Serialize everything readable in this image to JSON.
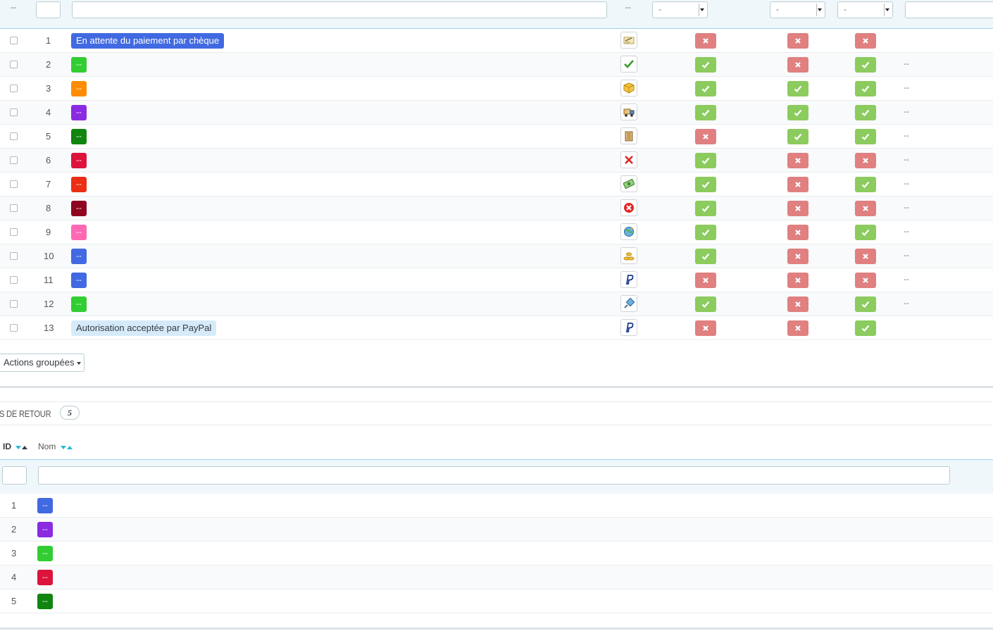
{
  "order_states_table": {
    "filters": {
      "id_dash": "--",
      "id_value": "",
      "name_value": "",
      "icon_dash": "--",
      "send_email": "-",
      "delivery": "-",
      "invoice": "-",
      "template_value": ""
    },
    "rows": [
      {
        "id": "1",
        "name": "En attente du paiement par chèque",
        "color": "#4169e1",
        "text_color": "#ffffff",
        "icon": "cheque-icon",
        "send_email": false,
        "delivery": false,
        "invoice": false,
        "template": ""
      },
      {
        "id": "2",
        "name": "--",
        "color": "#32cd32",
        "text_color": "#ffffff",
        "icon": "checkmark-icon",
        "send_email": true,
        "delivery": false,
        "invoice": true,
        "template": "--"
      },
      {
        "id": "3",
        "name": "--",
        "color": "#ff8c00",
        "text_color": "#ffffff",
        "icon": "package-icon",
        "send_email": true,
        "delivery": true,
        "invoice": true,
        "template": "--"
      },
      {
        "id": "4",
        "name": "--",
        "color": "#8a2be2",
        "text_color": "#ffffff",
        "icon": "shipping-truck-icon",
        "send_email": true,
        "delivery": true,
        "invoice": true,
        "template": "--"
      },
      {
        "id": "5",
        "name": "--",
        "color": "#108510",
        "text_color": "#ffffff",
        "icon": "delivered-box-icon",
        "send_email": false,
        "delivery": true,
        "invoice": true,
        "template": "--"
      },
      {
        "id": "6",
        "name": "--",
        "color": "#dc143c",
        "text_color": "#ffffff",
        "icon": "cancel-x-icon",
        "send_email": true,
        "delivery": false,
        "invoice": false,
        "template": "--"
      },
      {
        "id": "7",
        "name": "--",
        "color": "#ec2e15",
        "text_color": "#ffffff",
        "icon": "refund-money-icon",
        "send_email": true,
        "delivery": false,
        "invoice": true,
        "template": "--"
      },
      {
        "id": "8",
        "name": "--",
        "color": "#8f0621",
        "text_color": "#ffffff",
        "icon": "payment-error-icon",
        "send_email": true,
        "delivery": false,
        "invoice": false,
        "template": "--"
      },
      {
        "id": "9",
        "name": "--",
        "color": "#ff69b4",
        "text_color": "#ffffff",
        "icon": "backorder-globe-icon",
        "send_email": true,
        "delivery": false,
        "invoice": true,
        "template": "--"
      },
      {
        "id": "10",
        "name": "--",
        "color": "#4169e1",
        "text_color": "#ffffff",
        "icon": "bank-wire-coins-icon",
        "send_email": true,
        "delivery": false,
        "invoice": false,
        "template": "--"
      },
      {
        "id": "11",
        "name": "--",
        "color": "#4169e1",
        "text_color": "#ffffff",
        "icon": "paypal-icon",
        "send_email": false,
        "delivery": false,
        "invoice": false,
        "template": "--"
      },
      {
        "id": "12",
        "name": "--",
        "color": "#32cd32",
        "text_color": "#ffffff",
        "icon": "remote-payment-icon",
        "send_email": true,
        "delivery": false,
        "invoice": true,
        "template": "--"
      },
      {
        "id": "13",
        "name": "Autorisation acceptée par PayPal",
        "color": "#d6ebfa",
        "text_color": "#363a41",
        "icon": "paypal-icon",
        "send_email": false,
        "delivery": false,
        "invoice": true,
        "template": ""
      }
    ]
  },
  "bulk_actions": {
    "label": "Actions groupées"
  },
  "return_states_panel": {
    "title": "ATS DE RETOUR",
    "count": "5",
    "col_id": "ID",
    "col_name": "Nom",
    "filters": {
      "id_value": "",
      "name_value": ""
    },
    "rows": [
      {
        "id": "1",
        "name": "--",
        "color": "#4169e1"
      },
      {
        "id": "2",
        "name": "--",
        "color": "#8a2be2"
      },
      {
        "id": "3",
        "name": "--",
        "color": "#32cd32"
      },
      {
        "id": "4",
        "name": "--",
        "color": "#dc143c"
      },
      {
        "id": "5",
        "name": "--",
        "color": "#108510"
      }
    ]
  }
}
